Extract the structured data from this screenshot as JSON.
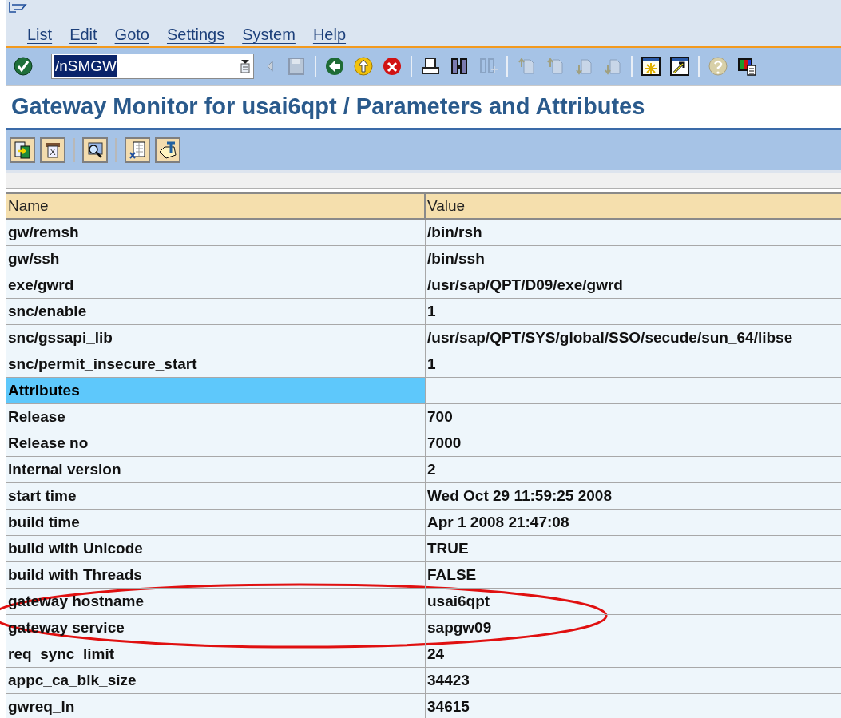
{
  "menu_bar": [
    "List",
    "Edit",
    "Goto",
    "Settings",
    "System",
    "Help"
  ],
  "command_field": {
    "value": "/nSMGW",
    "selected": true
  },
  "title": "Gateway Monitor for usai6qpt / Parameters and Attributes",
  "table": {
    "columns": [
      "Name",
      "Value"
    ],
    "rows": [
      {
        "kind": "param",
        "name": "gw/remsh",
        "value": "/bin/rsh"
      },
      {
        "kind": "param",
        "name": "gw/ssh",
        "value": "/bin/ssh"
      },
      {
        "kind": "param",
        "name": "exe/gwrd",
        "value": "/usr/sap/QPT/D09/exe/gwrd"
      },
      {
        "kind": "param",
        "name": "snc/enable",
        "value": "1"
      },
      {
        "kind": "param",
        "name": "snc/gssapi_lib",
        "value": "/usr/sap/QPT/SYS/global/SSO/secude/sun_64/libse"
      },
      {
        "kind": "param",
        "name": "snc/permit_insecure_start",
        "value": "1"
      },
      {
        "kind": "section",
        "name": "Attributes"
      },
      {
        "kind": "param",
        "name": "Release",
        "value": "700"
      },
      {
        "kind": "param",
        "name": "Release no",
        "value": "7000"
      },
      {
        "kind": "param",
        "name": "internal version",
        "value": "2"
      },
      {
        "kind": "param",
        "name": "start time",
        "value": "Wed Oct 29 11:59:25 2008"
      },
      {
        "kind": "param",
        "name": "build time",
        "value": "Apr  1 2008 21:47:08"
      },
      {
        "kind": "param",
        "name": "build with Unicode",
        "value": "TRUE"
      },
      {
        "kind": "param",
        "name": "build with Threads",
        "value": "FALSE"
      },
      {
        "kind": "param",
        "name": "gateway hostname",
        "value": "usai6qpt"
      },
      {
        "kind": "param",
        "name": "gateway service",
        "value": "sapgw09"
      },
      {
        "kind": "param",
        "name": "req_sync_limit",
        "value": "24"
      },
      {
        "kind": "param",
        "name": "appc_ca_blk_size",
        "value": "34423"
      },
      {
        "kind": "param",
        "name": "gwreq_ln",
        "value": "34615"
      }
    ]
  }
}
